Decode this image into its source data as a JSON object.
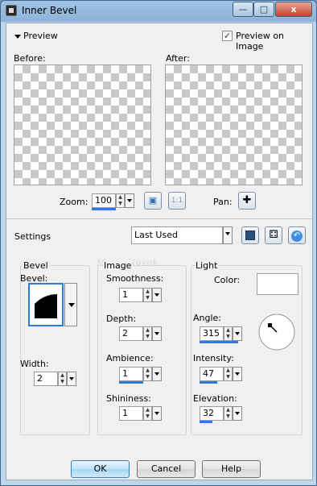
{
  "window": {
    "title": "Inner Bevel",
    "close_glyph": "x"
  },
  "preview": {
    "toggle_label": "Preview",
    "preview_on_image_label": "Preview on Image",
    "preview_on_image_checked": true,
    "before_label": "Before:",
    "after_label": "After:"
  },
  "zoom": {
    "label": "Zoom:",
    "value": "100",
    "one_to_one": "1:1"
  },
  "pan": {
    "label": "Pan:"
  },
  "settings": {
    "label": "Settings",
    "preset": "Last Used"
  },
  "watermark": "Maria Novak",
  "bevel_group": {
    "title": "Bevel",
    "bevel_label": "Bevel:",
    "width_label": "Width:",
    "width_value": "2"
  },
  "image_group": {
    "title": "Image",
    "smoothness_label": "Smoothness:",
    "smoothness_value": "1",
    "depth_label": "Depth:",
    "depth_value": "2",
    "ambience_label": "Ambience:",
    "ambience_value": "1",
    "shininess_label": "Shininess:",
    "shininess_value": "1"
  },
  "light_group": {
    "title": "Light",
    "color_label": "Color:",
    "color_value": "#ffffff",
    "angle_label": "Angle:",
    "angle_value": "315",
    "intensity_label": "Intensity:",
    "intensity_value": "47",
    "elevation_label": "Elevation:",
    "elevation_value": "32"
  },
  "buttons": {
    "ok": "OK",
    "cancel": "Cancel",
    "help": "Help"
  },
  "colors": {
    "accent": "#2f7ad6",
    "title_bar": "#9ec3e3",
    "dialog_bg": "#f0f0f0",
    "checker": "#c8c8c8"
  }
}
